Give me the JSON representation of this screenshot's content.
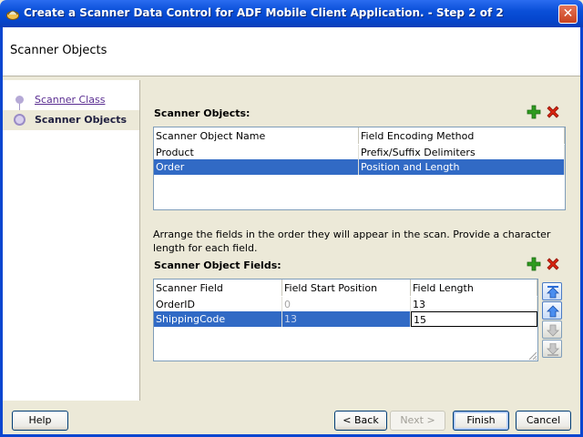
{
  "window": {
    "title": "Create a Scanner Data Control for ADF Mobile Client Application. - Step 2 of 2",
    "close_glyph": "✕"
  },
  "header": {
    "title": "Scanner Objects"
  },
  "nav": {
    "steps": [
      {
        "label": "Scanner Class",
        "state": "visited"
      },
      {
        "label": "Scanner Objects",
        "state": "current"
      }
    ]
  },
  "scanner_objects": {
    "label": "Scanner Objects:",
    "columns": [
      "Scanner Object Name",
      "Field Encoding Method"
    ],
    "rows": [
      [
        "Product",
        "Prefix/Suffix Delimiters"
      ],
      [
        "Order",
        "Position and Length"
      ]
    ],
    "selected_row": 1
  },
  "description": "Arrange the fields in the order they will appear in the scan.  Provide a character length for each field.",
  "scanner_fields": {
    "label": "Scanner Object Fields:",
    "columns": [
      "Scanner Field",
      "Field Start Position",
      "Field Length"
    ],
    "rows": [
      [
        "OrderID",
        "0",
        "13"
      ],
      [
        "ShippingCode",
        "13",
        "15"
      ]
    ],
    "selected_row": 1
  },
  "icons": {
    "add": "add-icon",
    "delete": "delete-icon",
    "move_top": "move-top-icon",
    "move_up": "move-up-icon",
    "move_down": "move-down-icon",
    "move_bottom": "move-bottom-icon"
  },
  "buttons": {
    "help": "Help",
    "back": "< Back",
    "next": "Next >",
    "finish": "Finish",
    "cancel": "Cancel"
  },
  "colors": {
    "title_bar": "#0a4fd8",
    "selection": "#316ac5",
    "add": "#2e9b1f",
    "delete": "#d8230f"
  }
}
